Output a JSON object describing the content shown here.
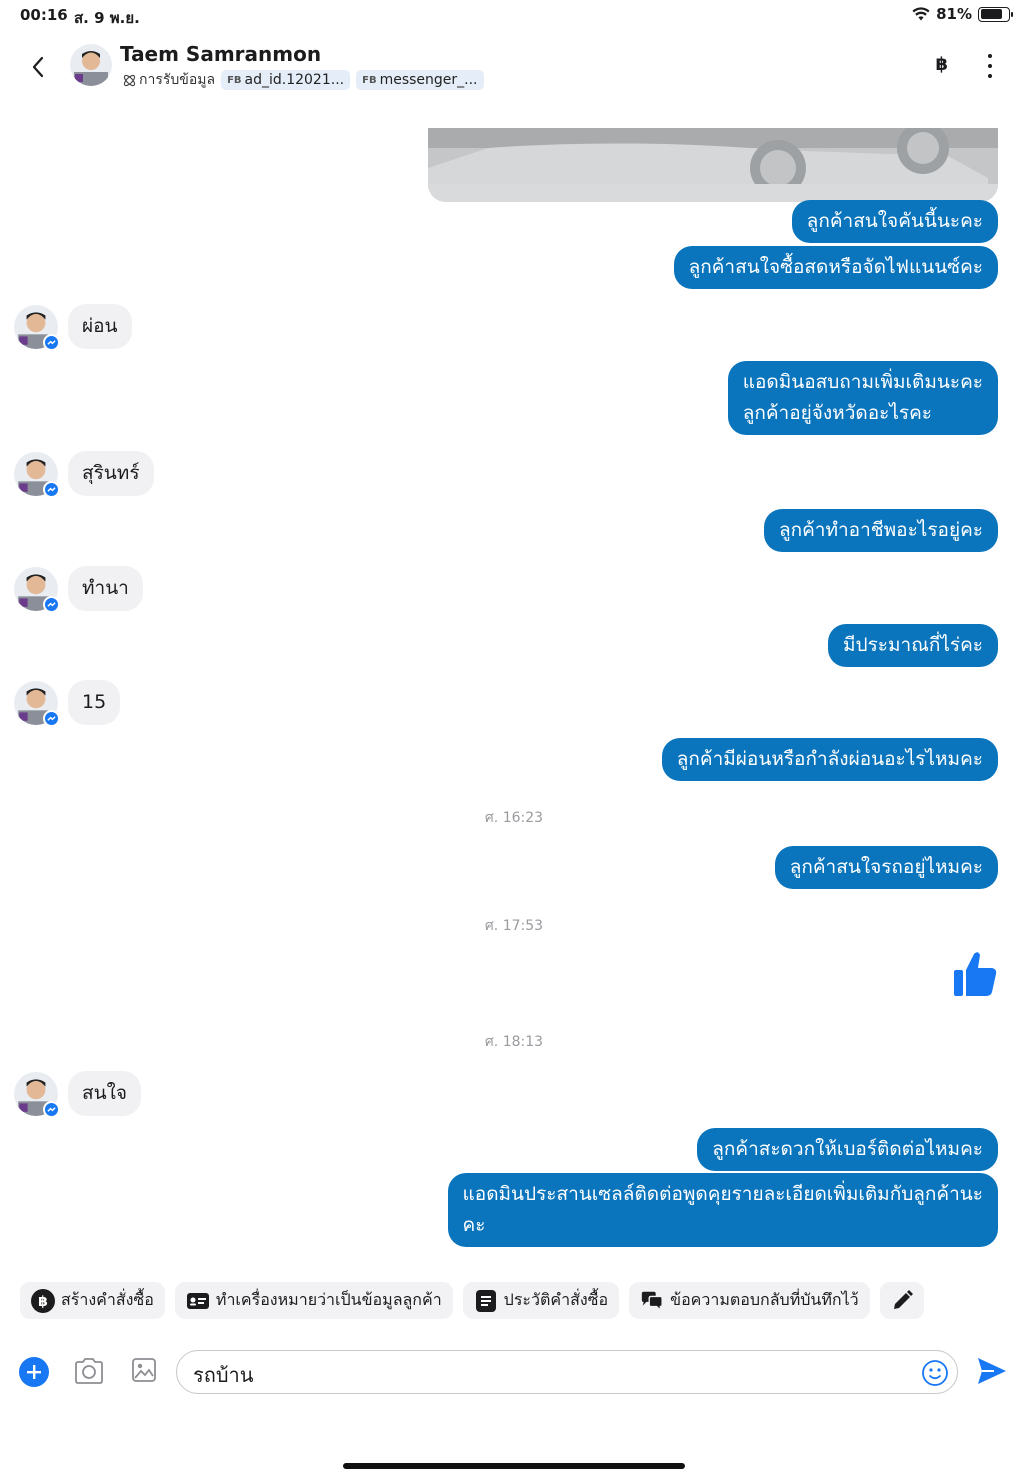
{
  "status": {
    "time": "00:16",
    "date": "ส. 9 พ.ย.",
    "battery": "81%",
    "battery_level": 0.81
  },
  "header": {
    "name": "Taem Samranmon",
    "tag_label": "การรับข้อมูล",
    "chips": [
      {
        "prefix": "FB",
        "text": "ad_id.12021..."
      },
      {
        "prefix": "FB",
        "text": "messenger_..."
      }
    ],
    "currency_symbol": "฿"
  },
  "messages": {
    "out1": "ลูกค้าสนใจคันนี้นะคะ",
    "out2": "ลูกค้าสนใจซื้อสดหรือจัดไฟแนนซ์คะ",
    "in1": "ผ่อน",
    "out3_line1": "แอดมินอสบถามเพิ่มเติมนะคะ",
    "out3_line2": "ลูกค้าอยู่จังหวัดอะไรคะ",
    "in2": "สุรินทร์",
    "out4": "ลูกค้าทำอาชีพอะไรอยู่คะ",
    "in3": "ทำนา",
    "out5": "มีประมาณกี่ไร่คะ",
    "in4": "15",
    "out6": "ลูกค้ามีผ่อนหรือกำลังผ่อนอะไรไหมคะ",
    "ts1": "ศ. 16:23",
    "out7": "ลูกค้าสนใจรถอยู่ไหมคะ",
    "ts2": "ศ. 17:53",
    "ts3": "ศ. 18:13",
    "in5": "สนใจ",
    "out8": "ลูกค้าสะดวกให้เบอร์ติดต่อไหมคะ",
    "out9_line1": "แอดมินประสานเซลล์ติดต่อพูดคุยรายละเอียดเพิ่มเติมกับลูกค้านะ",
    "out9_line2": "คะ"
  },
  "toolbar": {
    "create_order": "สร้างคำสั่งซื้อ",
    "mark_customer": "ทำเครื่องหมายว่าเป็นข้อมูลลูกค้า",
    "order_history": "ประวัติคำสั่งซื้อ",
    "saved_replies": "ข้อความตอบกลับที่บันทึกไว้"
  },
  "composer": {
    "value": "รถบ้าน"
  },
  "colors": {
    "accent": "#1877f2",
    "bubble_out": "#0a75bd",
    "bubble_in": "#f1f1f3"
  }
}
